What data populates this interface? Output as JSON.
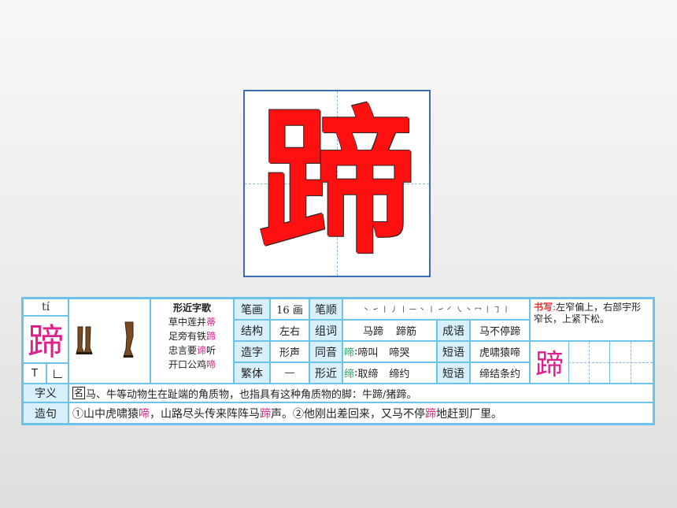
{
  "big_char": "蹄",
  "card": {
    "pinyin": "tí",
    "char": "蹄",
    "radical_label": "T",
    "radical": "𠃊",
    "poem_title": "形近字歌",
    "poem_lines": [
      {
        "pre": "草中莲并",
        "hl": "蒂"
      },
      {
        "pre": "足旁有铁",
        "hl": "蹄"
      },
      {
        "pre": "忠言要",
        "hl": "谛",
        "post": "听"
      },
      {
        "pre": "开口公鸡",
        "hl": "啼"
      }
    ],
    "rows": {
      "stroke_count_label": "笔画",
      "stroke_count": "16 画",
      "stroke_order_label": "笔顺",
      "stroke_order_glyphs": "丶 ㇀ 丨 丿 丨 一 丶 丨 ㇀ ㇒ ㇏ 丶 冖 丨 ㇆ 丨",
      "structure_label": "结构",
      "structure": "左右",
      "words_label": "组词",
      "words": [
        "马蹄",
        "蹄筋"
      ],
      "idiom_label": "成语",
      "idiom1": "马不停蹄",
      "formation_label": "造字",
      "formation": "形声",
      "homophone_label": "同音",
      "homophone_char": "啼",
      "homophone_words": [
        "啼叫",
        "啼哭"
      ],
      "phrase_label": "短语",
      "phrase1": "虎啸猿啼",
      "traditional_label": "繁体",
      "traditional": "—",
      "similar_label": "形近",
      "similar_char": "缔",
      "similar_words": [
        "取缔",
        "缔约"
      ],
      "phrase2_label": "短语",
      "phrase2": "缔结条约"
    },
    "writing_label": "书写",
    "writing_text": "左窄偏上，右部宇形窄长，上紧下松。",
    "practice_char": "蹄",
    "meaning_label": "字义",
    "meaning_tag": "名",
    "meaning_text": "马、牛等动物生在趾端的角质物，也指具有这种角质物的脚：牛蹄/猪蹄。",
    "sentence_label": "造句",
    "sentence": {
      "p1": "①山中虎啸猿",
      "h1": "啼",
      "p2": "，山路尽头传来阵阵马",
      "h2": "蹄",
      "p3": "声。②他刚出差回来，又马不停",
      "h3": "蹄",
      "p4": "地赶到厂里。"
    }
  },
  "colors": {
    "accent_border": "#6cc3ea",
    "label_bg": "#d8f0fb",
    "highlight_pink": "#e0208a",
    "highlight_green": "#22a860",
    "big_char_red": "#ff1010"
  }
}
